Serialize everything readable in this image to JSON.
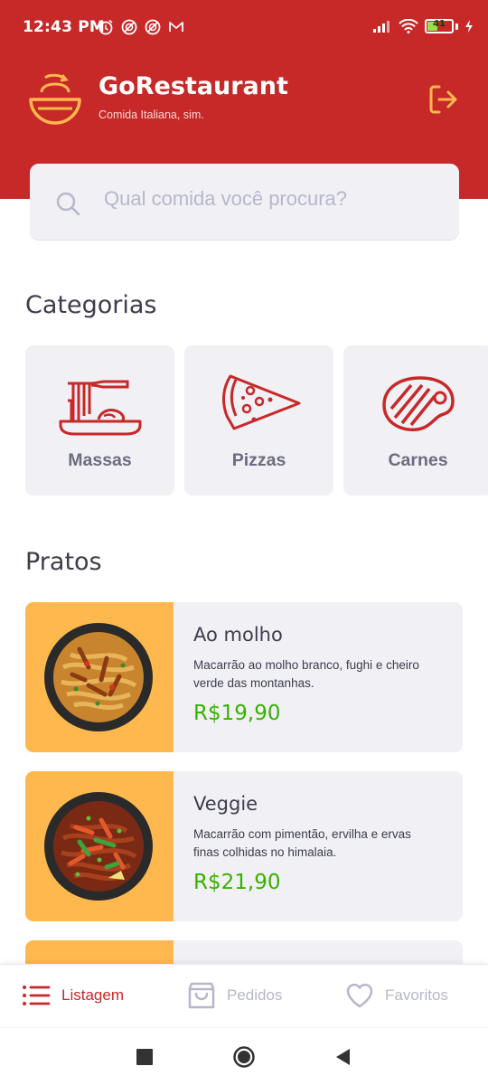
{
  "status_bar": {
    "time": "12:43 PM",
    "battery": "41"
  },
  "header": {
    "title": "GoRestaurant",
    "subtitle": "Comida Italiana, sim."
  },
  "search": {
    "placeholder": "Qual comida você procura?"
  },
  "categories": {
    "title": "Categorias",
    "items": [
      {
        "label": "Massas",
        "icon": "pasta-icon"
      },
      {
        "label": "Pizzas",
        "icon": "pizza-icon"
      },
      {
        "label": "Carnes",
        "icon": "steak-icon"
      }
    ]
  },
  "dishes": {
    "title": "Pratos",
    "items": [
      {
        "name": "Ao molho",
        "description": "Macarrão ao molho branco, fughi e cheiro verde das montanhas.",
        "price": "R$19,90"
      },
      {
        "name": "Veggie",
        "description": "Macarrão com pimentão, ervilha e ervas finas colhidas no himalaia.",
        "price": "R$21,90"
      }
    ]
  },
  "tabs": [
    {
      "label": "Listagem",
      "icon": "list-icon",
      "active": true
    },
    {
      "label": "Pedidos",
      "icon": "shopping-bag-icon",
      "active": false
    },
    {
      "label": "Favoritos",
      "icon": "heart-icon",
      "active": false
    }
  ],
  "colors": {
    "primary": "#C72828",
    "price": "#39B100",
    "card": "#F0F0F5",
    "food_bg": "#FFB84D"
  }
}
